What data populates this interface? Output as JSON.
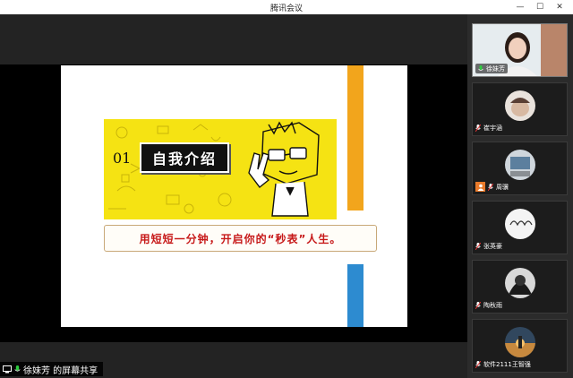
{
  "window": {
    "title": "腾讯会议"
  },
  "window_controls": {
    "minimize": "—",
    "maximize": "☐",
    "close": "✕"
  },
  "slide": {
    "number": "01",
    "heading": "自我介绍",
    "slogan": "用短短一分钟，开启你的“秒表”人生。"
  },
  "participants": [
    {
      "name": "徐妹芳",
      "active": true,
      "camera_off": false
    },
    {
      "name": "崔宇涵",
      "active": false,
      "camera_off": false
    },
    {
      "name": "周骥",
      "active": false,
      "camera_off": true
    },
    {
      "name": "张英豪",
      "active": false,
      "camera_off": false
    },
    {
      "name": "陶秋雨",
      "active": false,
      "camera_off": false
    },
    {
      "name": "软件2111王智强",
      "active": false,
      "camera_off": false
    }
  ],
  "share_bar": {
    "text": "徐妹芳 的屏幕共享"
  },
  "colors": {
    "orange": "#f2a51c",
    "blue": "#2d8bd0",
    "banner_yellow": "#f5e313",
    "slogan_red": "#c71a1a"
  },
  "icons": {
    "mic": "microphone-icon",
    "screen_share": "screen-share-icon",
    "camera_off": "camera-off-icon"
  }
}
